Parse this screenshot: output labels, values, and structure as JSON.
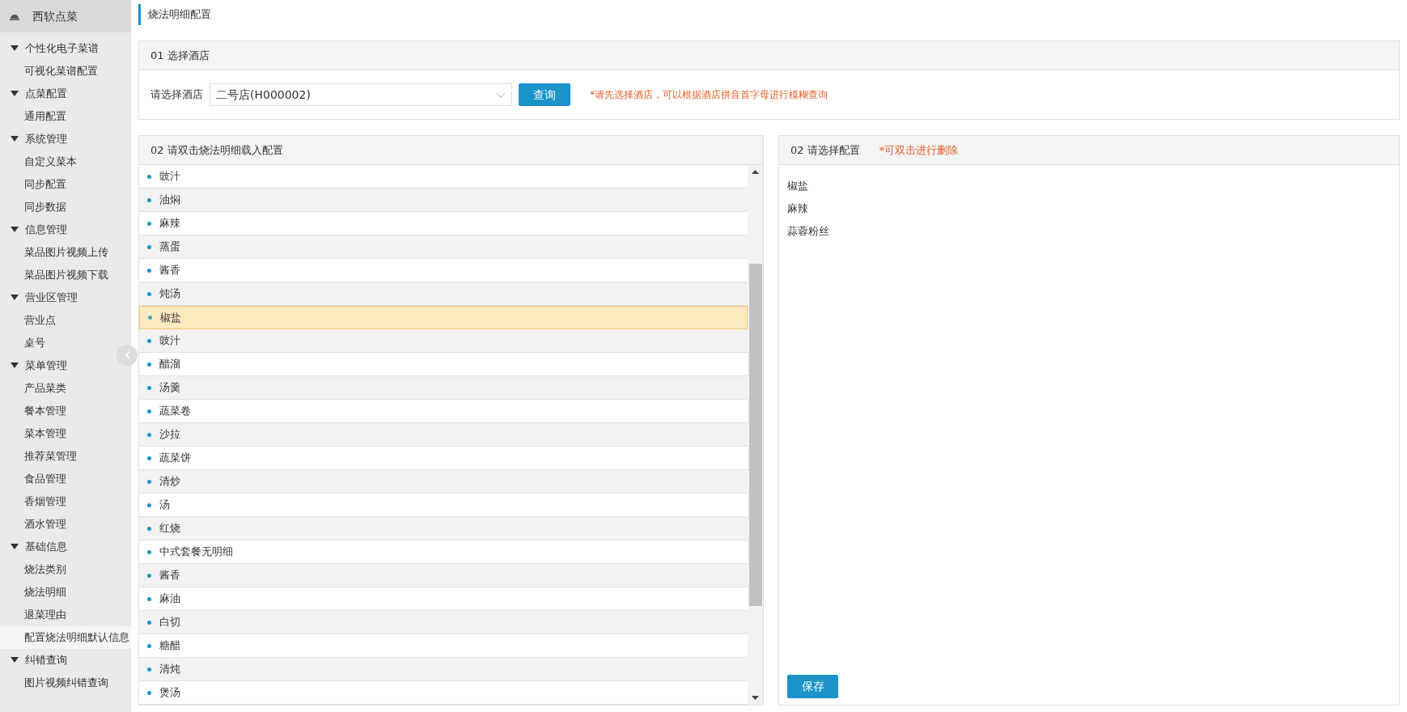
{
  "sidebar": {
    "title": "西软点菜",
    "groups": [
      {
        "label": "个性化电子菜谱",
        "expanded": true,
        "children": [
          {
            "label": "可视化菜谱配置",
            "selected": false
          }
        ]
      },
      {
        "label": "点菜配置",
        "expanded": true,
        "children": [
          {
            "label": "通用配置",
            "selected": false
          }
        ]
      },
      {
        "label": "系统管理",
        "expanded": true,
        "children": [
          {
            "label": "自定义菜本",
            "selected": false
          },
          {
            "label": "同步配置",
            "selected": false
          },
          {
            "label": "同步数据",
            "selected": false
          }
        ]
      },
      {
        "label": "信息管理",
        "expanded": true,
        "children": [
          {
            "label": "菜品图片视频上传",
            "selected": false
          },
          {
            "label": "菜品图片视频下载",
            "selected": false
          }
        ]
      },
      {
        "label": "营业区管理",
        "expanded": true,
        "children": [
          {
            "label": "营业点",
            "selected": false
          },
          {
            "label": "桌号",
            "selected": false
          }
        ]
      },
      {
        "label": "菜单管理",
        "expanded": true,
        "children": [
          {
            "label": "产品菜类",
            "selected": false
          },
          {
            "label": "餐本管理",
            "selected": false
          },
          {
            "label": "菜本管理",
            "selected": false
          },
          {
            "label": "推荐菜管理",
            "selected": false
          },
          {
            "label": "食品管理",
            "selected": false
          },
          {
            "label": "香烟管理",
            "selected": false
          },
          {
            "label": "酒水管理",
            "selected": false
          }
        ]
      },
      {
        "label": "基础信息",
        "expanded": true,
        "children": [
          {
            "label": "烧法类别",
            "selected": false
          },
          {
            "label": "烧法明细",
            "selected": false
          },
          {
            "label": "退菜理由",
            "selected": false
          },
          {
            "label": "配置烧法明细默认信息",
            "selected": true
          }
        ]
      },
      {
        "label": "纠错查询",
        "expanded": true,
        "children": [
          {
            "label": "图片视频纠错查询",
            "selected": false
          }
        ]
      }
    ]
  },
  "page_title": "烧法明细配置",
  "hotel_section": {
    "title": "01 选择酒店",
    "label": "请选择酒店",
    "select_value": "二号店(H000002)",
    "query_button": "查询",
    "hint": "*请先选择酒店，可以根据酒店拼音首字母进行模糊查询"
  },
  "detail_list": {
    "title": "02 请双击烧法明细载入配置",
    "items": [
      {
        "label": "豉汁",
        "selected": false
      },
      {
        "label": "油焖",
        "selected": false
      },
      {
        "label": "麻辣",
        "selected": false
      },
      {
        "label": "蒸蛋",
        "selected": false
      },
      {
        "label": "酱香",
        "selected": false
      },
      {
        "label": "炖汤",
        "selected": false
      },
      {
        "label": "椒盐",
        "selected": true
      },
      {
        "label": "豉汁",
        "selected": false
      },
      {
        "label": "醋溜",
        "selected": false
      },
      {
        "label": "汤羹",
        "selected": false
      },
      {
        "label": "蔬菜卷",
        "selected": false
      },
      {
        "label": "沙拉",
        "selected": false
      },
      {
        "label": "蔬菜饼",
        "selected": false
      },
      {
        "label": "清炒",
        "selected": false
      },
      {
        "label": "汤",
        "selected": false
      },
      {
        "label": "红烧",
        "selected": false
      },
      {
        "label": "中式套餐无明细",
        "selected": false
      },
      {
        "label": "酱香",
        "selected": false
      },
      {
        "label": "麻油",
        "selected": false
      },
      {
        "label": "白切",
        "selected": false
      },
      {
        "label": "糖醋",
        "selected": false
      },
      {
        "label": "清炖",
        "selected": false
      },
      {
        "label": "煲汤",
        "selected": false
      }
    ]
  },
  "config_panel": {
    "title": "02 请选择配置",
    "hint": "*可双击进行删除",
    "items": [
      "椒盐",
      "麻辣",
      "蒜蓉粉丝"
    ],
    "save_button": "保存"
  }
}
